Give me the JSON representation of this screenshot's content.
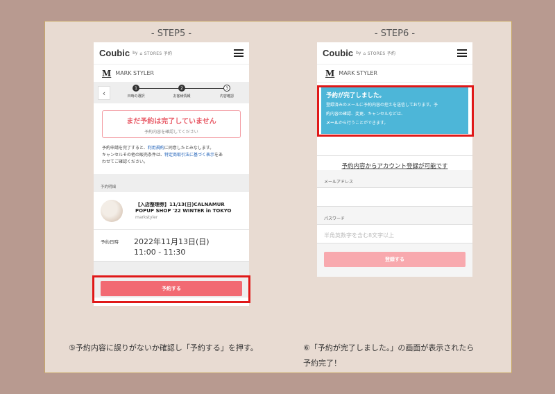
{
  "step5": {
    "heading": "- STEP5 -",
    "brand": {
      "logo": "Coubic",
      "by": "by",
      "stores": "⌂ STORES 予約"
    },
    "shop": {
      "mark": "M",
      "name": "MARK STYLER"
    },
    "stepper": {
      "back": "‹",
      "n1": "1",
      "n2": "2",
      "n3": "3",
      "l1": "日時の選択",
      "l2": "お客様情報",
      "l3": "内容確認"
    },
    "warning": {
      "title": "まだ予約は完了していません",
      "sub": "予約内容を確認してください"
    },
    "terms": {
      "p1": "予約申請を完了すると、",
      "link1": "利用規約",
      "p2": "に同意したとみなします。",
      "p3": "キャンセルその他の販売条件は、",
      "link2": "特定商取引法に基づく表示",
      "p4": "をあ",
      "p5": "わせてご確認ください。"
    },
    "section": "予約明細",
    "item": {
      "title": "【入店整理券】11/13(日)CALNAMUR POPUP SHOP '22 WINTER in TOKYO",
      "shop": "markstyler"
    },
    "datetime": {
      "label": "予約日時",
      "date": "2022年11月13日(日)",
      "time": "11:00 - 11:30"
    },
    "button": "予約する",
    "caption": "⑤予約内容に誤りがないか確認し「予約する」を押す。"
  },
  "step6": {
    "heading": "- STEP6 -",
    "brand": {
      "logo": "Coubic",
      "by": "by",
      "stores": "⌂ STORES 予約"
    },
    "shop": {
      "mark": "M",
      "name": "MARK STYLER"
    },
    "done": {
      "title": "予約が完了しました。",
      "l1": "登録済みのメールに予約内容の控えを送信しております。予",
      "l2": "約内容の確認、変更、キャンセルなどは、",
      "bold": "メール",
      "l3": "から行うことができます。"
    },
    "account_link": "予約内容からアカウント登録が可能です",
    "email_label": "メールアドレス",
    "password_label": "パスワード",
    "password_placeholder": "半角英数字を含む8文字以上",
    "register_button": "登録する",
    "caption_l1": "⑥「予約が完了しました。」の画面が表示されたら",
    "caption_l2": "予約完了！"
  },
  "colors": {
    "background": "#b89a90",
    "panel": "#e8dbd2",
    "accent_red": "#f26a73",
    "highlight": "#e01818",
    "done_blue": "#4db6d8"
  }
}
